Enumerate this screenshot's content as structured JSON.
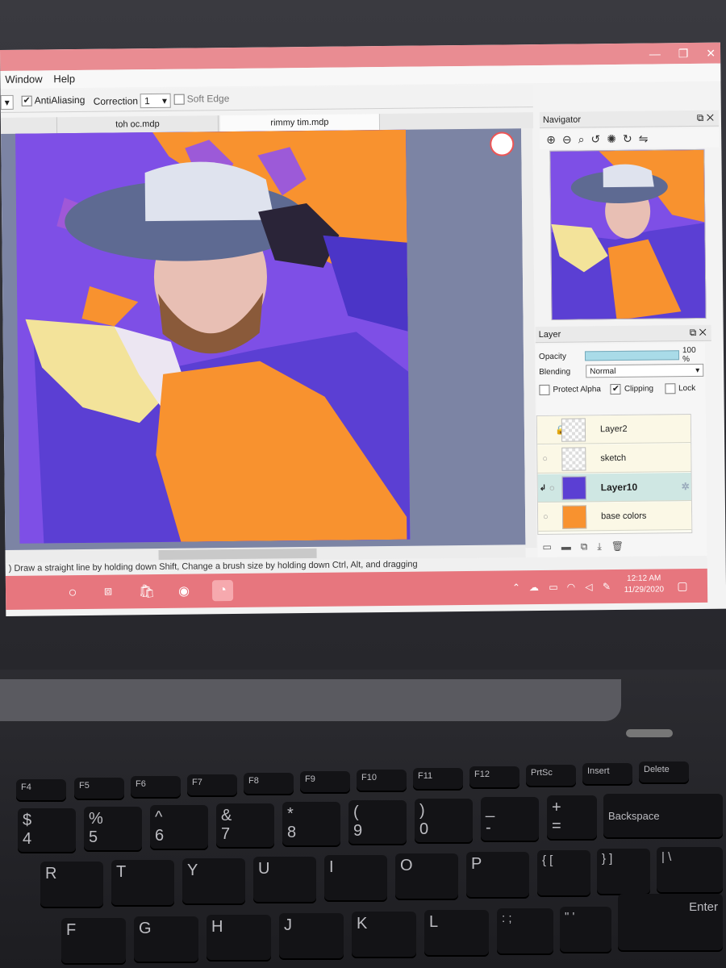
{
  "app": {
    "window_controls": [
      "—",
      "❐",
      "✕"
    ],
    "menu": [
      "Window",
      "Help"
    ],
    "toolbar": {
      "antialiasing_label": "AntiAliasing",
      "correction_label": "Correction",
      "correction_value": "1",
      "soft_edge_label": "Soft Edge"
    },
    "tabs": [
      "toh oc.mdp",
      "rimmy tim.mdp"
    ],
    "status_hint": ") Draw a straight line by holding down Shift, Change a brush size by holding down Ctrl, Alt, and dragging"
  },
  "navigator": {
    "title": "Navigator",
    "tools": [
      "zoom-in-icon",
      "zoom-out-icon",
      "zoom-fit-icon",
      "rotate-left-icon",
      "rotate-reset-icon",
      "rotate-right-icon",
      "flip-icon"
    ]
  },
  "layer_panel": {
    "title": "Layer",
    "opacity_label": "Opacity",
    "opacity_value": "100 %",
    "opacity_level": 1.0,
    "blending_label": "Blending",
    "blending_value": "Normal",
    "protect_alpha_label": "Protect Alpha",
    "clipping_label": "Clipping",
    "lock_label": "Lock",
    "layers": [
      {
        "name": "Layer2",
        "selected": false
      },
      {
        "name": "sketch",
        "selected": false
      },
      {
        "name": "Layer10",
        "selected": true
      },
      {
        "name": "base colors",
        "selected": false
      }
    ]
  },
  "taskbar": {
    "time": "12:12 AM",
    "date": "11/29/2020"
  },
  "keyboard": {
    "fn_row": [
      "F4",
      "F5",
      "F6",
      "F7",
      "F8",
      "F9",
      "F10",
      "F11",
      "F12",
      "PrtSc",
      "Insert",
      "Delete"
    ],
    "num_row": [
      [
        "$",
        "4"
      ],
      [
        "%",
        "5"
      ],
      [
        "^",
        "6"
      ],
      [
        "&",
        "7"
      ],
      [
        "*",
        "8"
      ],
      [
        "(",
        "9"
      ],
      [
        ")",
        "0"
      ],
      [
        "_",
        "-"
      ],
      [
        "+",
        "="
      ],
      [
        "",
        "Backspace"
      ]
    ],
    "top_row": [
      "R",
      "T",
      "Y",
      "U",
      "I",
      "O",
      "P",
      "{ [",
      "} ]",
      "| \\"
    ],
    "home_row": [
      "F",
      "G",
      "H",
      "J",
      "K",
      "L",
      ": ;",
      "\" '",
      "Enter"
    ]
  },
  "colors": {
    "titlebar": "#e98c92",
    "taskbar": "#e7767e",
    "canvas_bg": "#7c84a4",
    "art_purple": "#7e4fe6",
    "art_orange": "#f8922f",
    "selected_layer": "#cfe7e3"
  }
}
